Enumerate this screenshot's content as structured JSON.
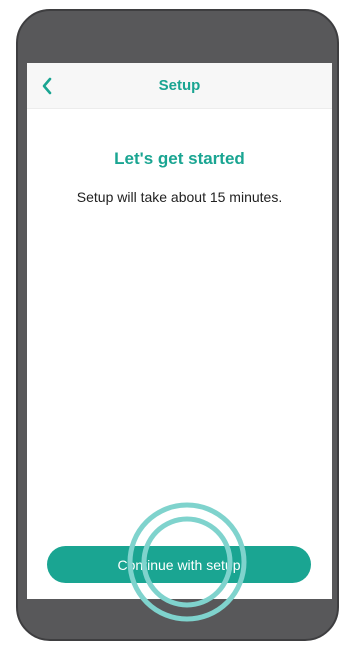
{
  "header": {
    "title": "Setup",
    "back_icon": "chevron-left-icon"
  },
  "main": {
    "heading": "Let's get started",
    "subtext": "Setup will take about 15 minutes."
  },
  "footer": {
    "continue_label": "Continue with setup"
  },
  "colors": {
    "accent": "#1aa592",
    "device_frame": "#58585a",
    "tap_indicator": "#7fd3cd"
  }
}
